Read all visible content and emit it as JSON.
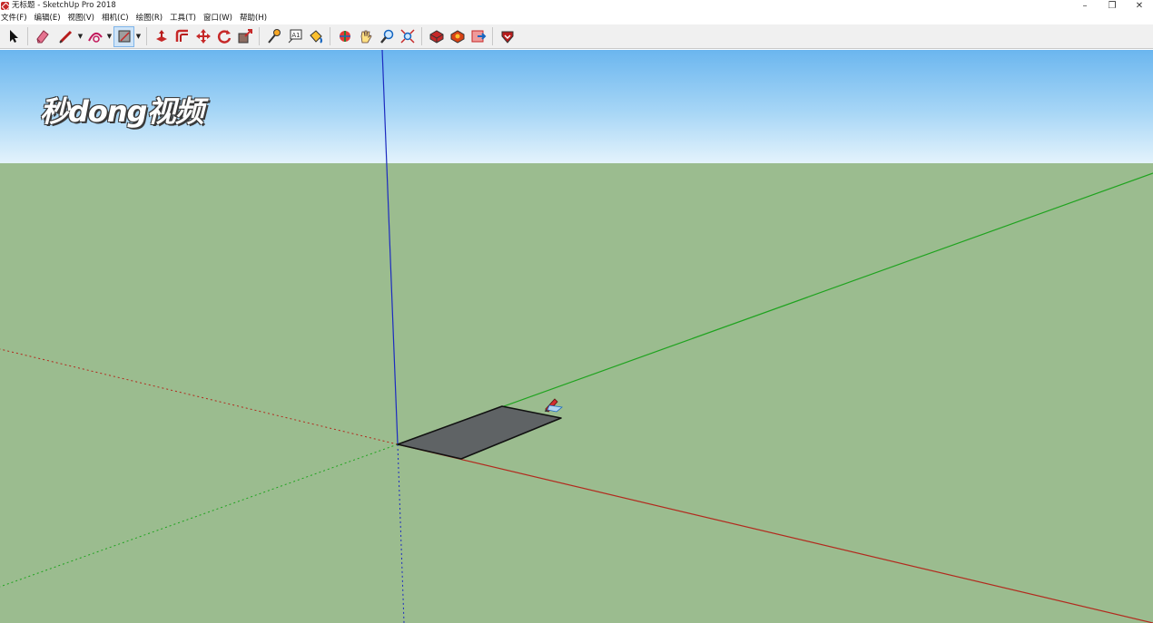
{
  "window": {
    "title": "无标题 - SketchUp Pro 2018",
    "controls": {
      "minimize": "–",
      "restore": "❐",
      "close": "✕"
    }
  },
  "menubar": {
    "items": [
      "文件(F)",
      "编辑(E)",
      "视图(V)",
      "相机(C)",
      "绘图(R)",
      "工具(T)",
      "窗口(W)",
      "帮助(H)"
    ]
  },
  "toolbar": {
    "tools": [
      {
        "name": "select-tool-icon"
      },
      {
        "name": "eraser-tool-icon"
      },
      {
        "name": "line-tool-icon",
        "dropdown": true
      },
      {
        "name": "arc-tool-icon",
        "dropdown": true
      },
      {
        "name": "rectangle-tool-icon",
        "dropdown": true,
        "active": true
      },
      {
        "name": "push-pull-tool-icon"
      },
      {
        "name": "offset-tool-icon"
      },
      {
        "name": "move-tool-icon"
      },
      {
        "name": "rotate-tool-icon"
      },
      {
        "name": "scale-tool-icon"
      },
      {
        "name": "tape-measure-tool-icon"
      },
      {
        "name": "text-tool-icon"
      },
      {
        "name": "paint-bucket-tool-icon"
      },
      {
        "name": "orbit-tool-icon"
      },
      {
        "name": "pan-tool-icon"
      },
      {
        "name": "zoom-tool-icon"
      },
      {
        "name": "zoom-extents-tool-icon"
      },
      {
        "name": "3d-warehouse-icon"
      },
      {
        "name": "extension-warehouse-icon"
      },
      {
        "name": "layout-send-icon"
      },
      {
        "name": "extension-manager-icon"
      }
    ],
    "text_tool_label": "A1"
  },
  "viewport": {
    "sky_color": "#8fcaf3",
    "ground_color": "#9bbc8f",
    "axis_colors": {
      "red": "#b22a1e",
      "green": "#1fa31f",
      "blue": "#1c2bc0"
    },
    "face_color": "#5f6365",
    "cursor": "rectangle-pencil-cursor-icon"
  },
  "watermark": {
    "text": "秒dong视频"
  }
}
